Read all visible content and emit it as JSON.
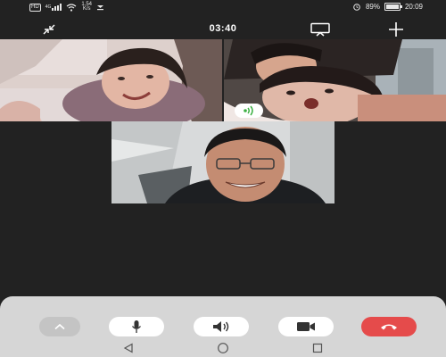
{
  "status_bar": {
    "hd_badge": "HD",
    "network_type": "4G",
    "net_speed_value": "1.54",
    "net_speed_unit": "K/s",
    "battery_percent_text": "89%",
    "battery_level": 0.89,
    "time": "20:09",
    "icons": [
      "hd-icon",
      "signal-icon",
      "wifi-icon",
      "notification-icon",
      "alarm-icon",
      "battery-icon"
    ]
  },
  "call": {
    "timer": "03:40",
    "icons": {
      "minimize": "minimize-icon",
      "cast": "cast-icon",
      "add_participant": "add-icon"
    }
  },
  "participants": [
    {
      "tile": "participant-video-top-left",
      "speaking": false
    },
    {
      "tile": "participant-video-top-right",
      "speaking": true
    },
    {
      "tile": "participant-video-bottom-center",
      "speaking": false
    }
  ],
  "controls": {
    "collapse_icon": "chevron-up-icon",
    "mic_icon": "microphone-icon",
    "speaker_icon": "speaker-icon",
    "camera_icon": "video-camera-icon",
    "hangup_icon": "hang-up-icon"
  },
  "colors": {
    "background": "#222222",
    "control_bar": "#d6d6d6",
    "hangup": "#e54b4b",
    "speaking": "#3cb043"
  },
  "nav_bar": {
    "icons": [
      "back-icon",
      "home-icon",
      "recents-icon"
    ]
  }
}
